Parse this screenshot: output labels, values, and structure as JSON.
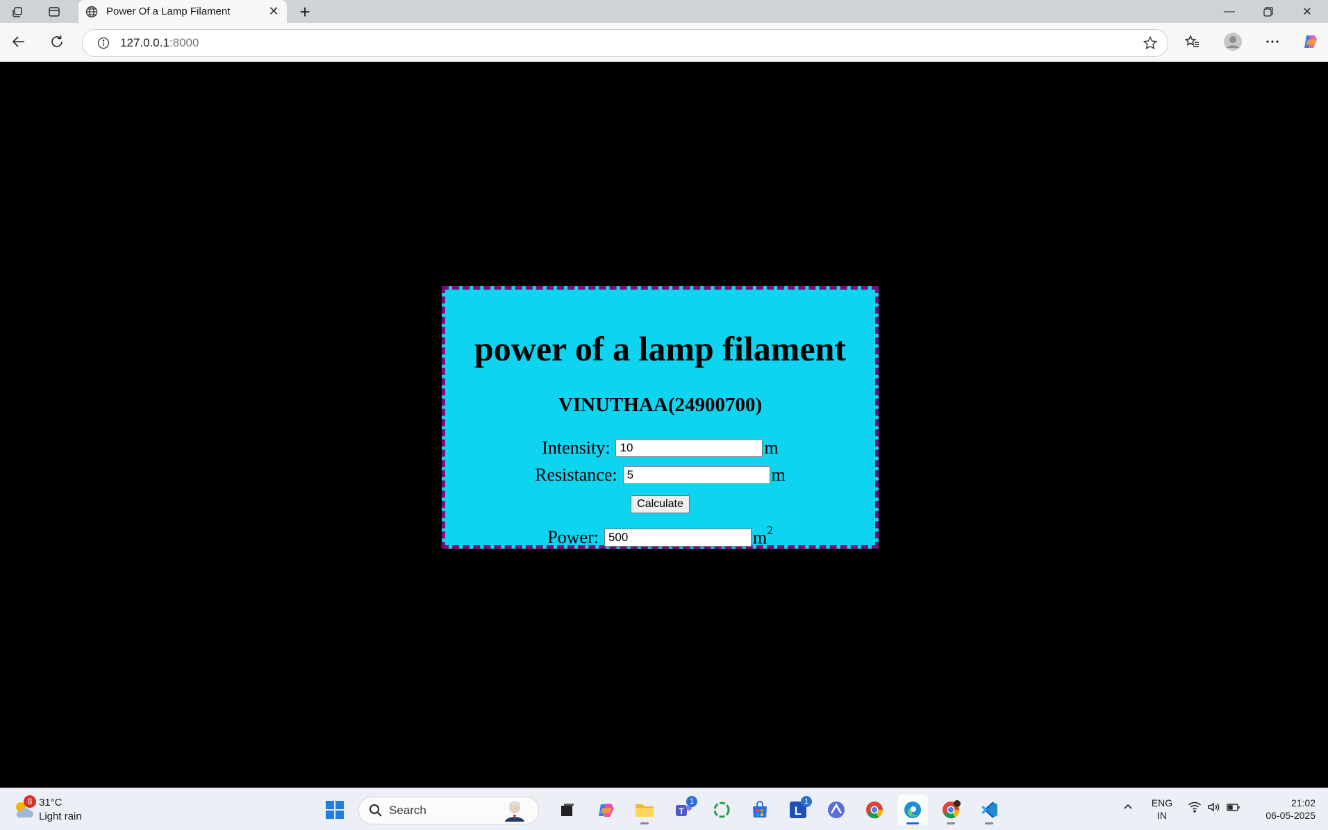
{
  "browser": {
    "tab_title": "Power Of a Lamp Filament",
    "address_host": "127.0.0.1",
    "address_port": ":8000"
  },
  "page": {
    "heading": "power of a lamp filament",
    "subheading": "VINUTHAA(24900700)",
    "intensity_label": "Intensity:",
    "intensity_value": "10",
    "intensity_unit": "m",
    "resistance_label": "Resistance:",
    "resistance_value": "5",
    "resistance_unit": "m",
    "calculate_label": "Calculate",
    "power_label": "Power:",
    "power_value": "500",
    "power_unit": "m",
    "power_unit_exponent": "2"
  },
  "colors": {
    "page_background": "#000000",
    "card_background": "#0fd4ef",
    "card_border": "#7a0f7a"
  },
  "taskbar": {
    "weather_badge": "8",
    "weather_temp": "31°C",
    "weather_desc": "Light rain",
    "search_placeholder": "Search",
    "teams_badge": "1",
    "launcher_badge": "1",
    "lang_line1": "ENG",
    "lang_line2": "IN",
    "time": "21:02",
    "date": "06-05-2025"
  }
}
